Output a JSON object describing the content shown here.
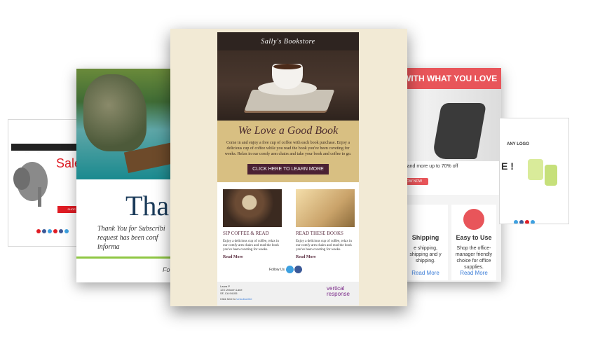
{
  "left_far": {
    "nav_items": [
      "· ··",
      "·· ···",
      "··· ·"
    ],
    "sale": "Sale",
    "button": "SHOP",
    "social_colors": [
      "#e01c24",
      "#3b5998",
      "#3da0e0",
      "#e01c24",
      "#3b5998",
      "#3da0e0"
    ]
  },
  "left_card": {
    "headline": "Tha",
    "body": "Thank You for Subscribi request has been conf informa",
    "footer": "Fo"
  },
  "center": {
    "store_name": "Sally's Bookstore",
    "headline": "We Love a Good Book",
    "intro": "Come in and enjoy a free cup of coffee with each book purchase. Enjoy a delicious cup of coffee while you read the book you've been coveting for weeks. Relax in our comfy arm chairs and take your book and coffee to go.",
    "cta": "CLICK HERE TO LEARN MORE",
    "col1": {
      "title": "SIP COFFEE & READ",
      "desc": "Enjoy a delicious cup of coffee, relax in our comfy arm chairs and read the book you've been coveting for weeks.",
      "more": "Read More"
    },
    "col2": {
      "title": "READ THESE BOOKS",
      "desc": "Enjoy a delicious cup of coffee, relax in our comfy arm chairs and read the book you've been coveting for weeks.",
      "more": "Read More"
    },
    "follow": "Follow Us",
    "address_name": "Laura P",
    "address_street": "123 Unicorn Lane",
    "address_city": "SF, CA 94105",
    "click_here": "Click here to",
    "unsubscribe": "Unsubscribe",
    "brand": "vertical response"
  },
  "right_card": {
    "banner": "WITH WHAT YOU LOVE",
    "offer": "or, and more up to 70% off",
    "offer_button": "OW NOW",
    "box1_title": "Shipping",
    "box1_desc": "e shipping, shipping and y shipping.",
    "box1_more": "Read More",
    "box2_title": "Easy to Use",
    "box2_desc": "Shop the office-manager friendly choice for office supplies.",
    "box2_more": "Read More"
  },
  "right_far": {
    "logo": "ANY LOGO",
    "sale": "E !"
  }
}
